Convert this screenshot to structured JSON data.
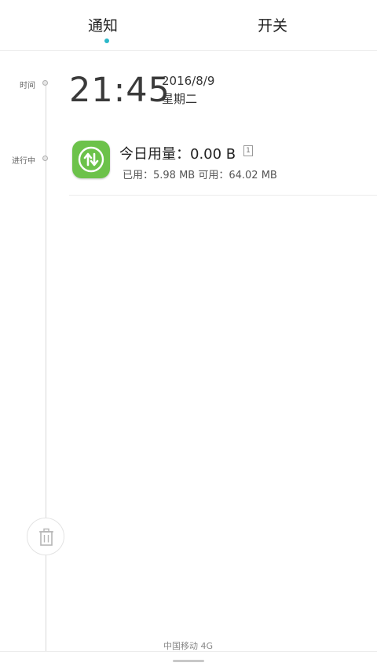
{
  "tabs": {
    "notify": "通知",
    "switch": "开关"
  },
  "timeline": {
    "time_label": "时间",
    "ongoing_label": "进行中"
  },
  "clock": {
    "time": "21:45",
    "date": "2016/8/9",
    "weekday": "星期二"
  },
  "notification": {
    "title": "今日用量：0.00 B",
    "sim_badge": "1",
    "detail": "已用：5.98 MB 可用：64.02 MB",
    "icon": "data-usage-arrows-icon",
    "icon_color": "#6cc24a"
  },
  "footer": {
    "carrier": "中国移动 4G"
  },
  "colors": {
    "accent": "#2bb8c9"
  }
}
